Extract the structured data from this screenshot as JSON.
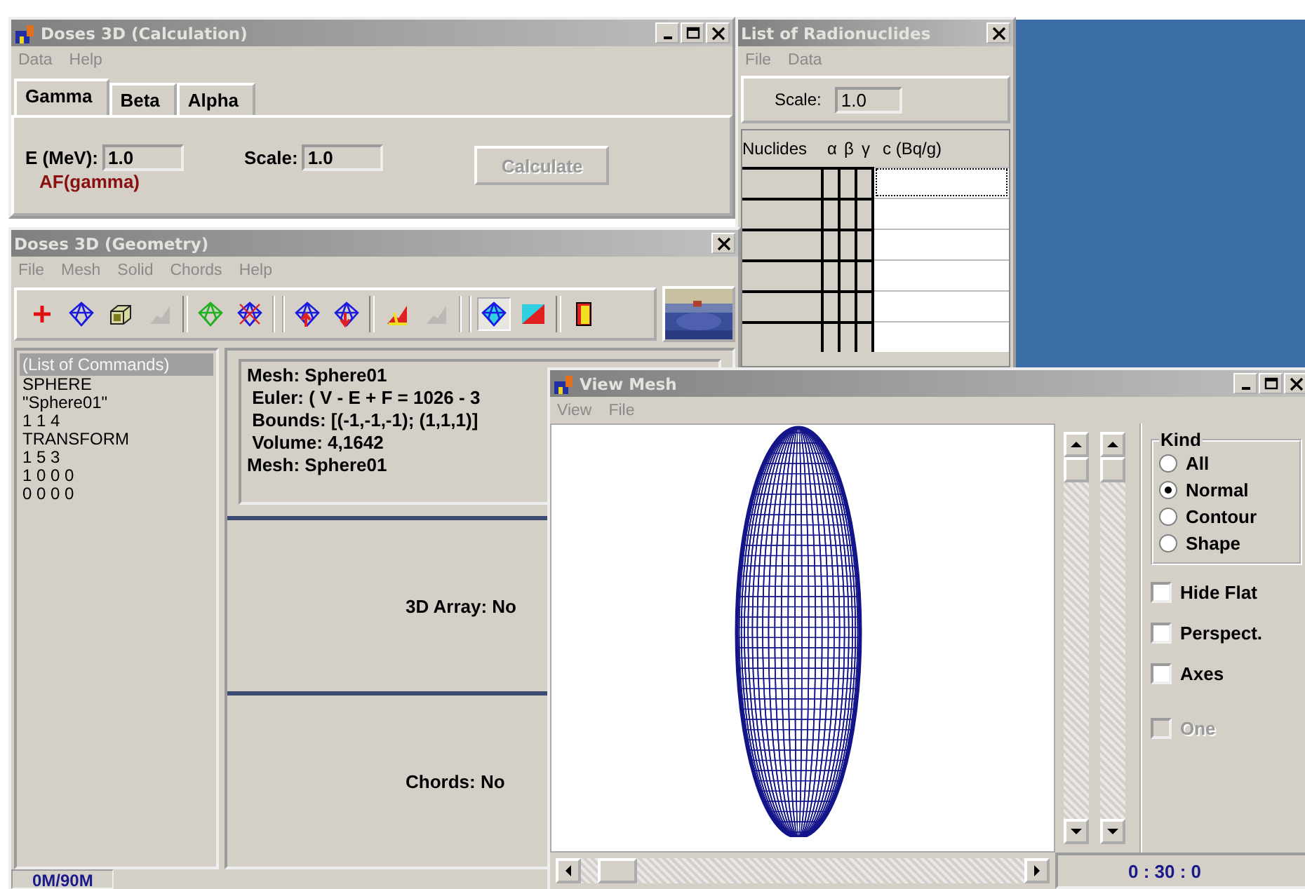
{
  "calc_window": {
    "title": "Doses 3D (Calculation)",
    "menu": [
      "Data",
      "Help"
    ],
    "tabs": [
      {
        "label": "Gamma",
        "selected": true
      },
      {
        "label": "Beta",
        "selected": false
      },
      {
        "label": "Alpha",
        "selected": false
      }
    ],
    "energy": {
      "label": "E (MeV):",
      "value": "1.0"
    },
    "scale": {
      "label": "Scale:",
      "value": "1.0"
    },
    "result_label": "AF(gamma)",
    "calculate_button": {
      "label": "Calculate",
      "disabled": true
    }
  },
  "nuclides_window": {
    "title": "List of Radionuclides",
    "menu": [
      "File",
      "Data"
    ],
    "scale": {
      "label": "Scale:",
      "value": "1.0"
    },
    "table": {
      "columns": [
        "Nuclides",
        "α",
        "β",
        "γ",
        "c (Bq/g)"
      ]
    }
  },
  "geometry_window": {
    "title": "Doses 3D (Geometry)",
    "menu": [
      "File",
      "Mesh",
      "Solid",
      "Chords",
      "Help"
    ],
    "toolbar": [
      [
        {
          "kind": "plus",
          "disabled": false,
          "pressed": false
        },
        {
          "kind": "mesh",
          "disabled": false,
          "pressed": false
        },
        {
          "kind": "box",
          "disabled": false,
          "pressed": false
        },
        {
          "kind": "chart",
          "disabled": true,
          "pressed": false
        }
      ],
      [
        {
          "kind": "mesh-green",
          "disabled": false,
          "pressed": false
        },
        {
          "kind": "mesh-red",
          "disabled": false,
          "pressed": false
        }
      ],
      [
        {
          "kind": "mesh-up",
          "disabled": false,
          "pressed": false
        },
        {
          "kind": "mesh-down",
          "disabled": false,
          "pressed": false
        }
      ],
      [
        {
          "kind": "chart",
          "disabled": false,
          "pressed": false
        },
        {
          "kind": "chart",
          "disabled": true,
          "pressed": false
        }
      ],
      [
        {
          "kind": "mesh-fill",
          "disabled": false,
          "pressed": true
        },
        {
          "kind": "split-square",
          "disabled": false,
          "pressed": false
        }
      ],
      [
        {
          "kind": "door",
          "disabled": false,
          "pressed": false
        }
      ]
    ],
    "commands": {
      "header": "(List of Commands)",
      "lines": [
        "SPHERE",
        "\"Sphere01\"",
        "1 1 4",
        "TRANSFORM",
        "1 5 3",
        "1 0 0 0",
        "0 0 0 0"
      ]
    },
    "info": [
      "Mesh: Sphere01",
      " Euler: ( V - E + F = 1026 - 3",
      " Bounds: [(-1,-1,-1); (1,1,1)]",
      " Volume: 4,1642",
      "Mesh: Sphere01"
    ],
    "array_status": "3D Array: No",
    "chords_status": "Chords: No",
    "memory": "0M/90M"
  },
  "view_mesh_window": {
    "title": "View Mesh",
    "menu": [
      "View",
      "File"
    ],
    "kind_group": {
      "title": "Kind",
      "options": [
        {
          "label": "All",
          "selected": false
        },
        {
          "label": "Normal",
          "selected": true
        },
        {
          "label": "Contour",
          "selected": false
        },
        {
          "label": "Shape",
          "selected": false
        }
      ]
    },
    "checkboxes": [
      {
        "label": "Hide Flat",
        "checked": false,
        "disabled": false
      },
      {
        "label": "Perspect.",
        "checked": false,
        "disabled": false
      },
      {
        "label": "Axes",
        "checked": false,
        "disabled": false
      },
      {
        "label": "One",
        "checked": false,
        "disabled": true
      }
    ],
    "time": "0 : 30 : 0"
  }
}
